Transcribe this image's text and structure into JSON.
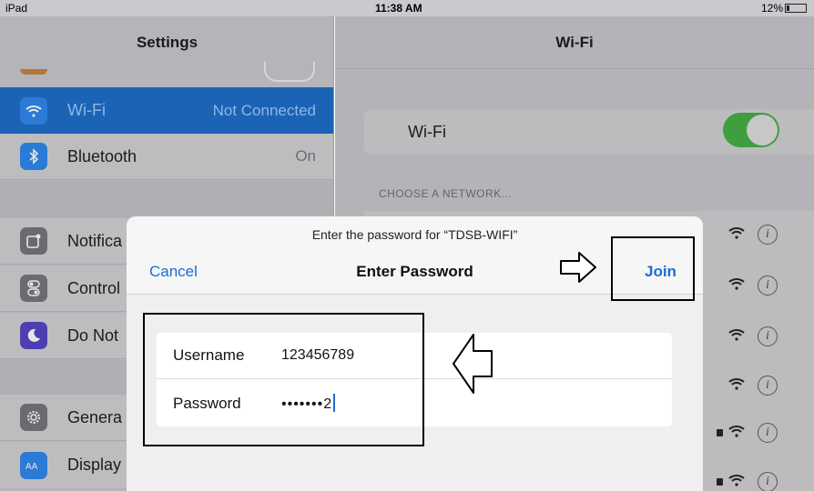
{
  "status_bar": {
    "device": "iPad",
    "time": "11:38 AM",
    "battery": "12%"
  },
  "sidebar": {
    "title": "Settings",
    "items": [
      {
        "label": "Wi-Fi",
        "value": "Not Connected",
        "icon": "wifi-icon",
        "color": "#2a7ad6",
        "selected": true
      },
      {
        "label": "Bluetooth",
        "value": "On",
        "icon": "bluetooth-icon",
        "color": "#2a7ad6"
      },
      {
        "label": "Notifica",
        "icon": "notifications-icon",
        "color": "#6b6b6f"
      },
      {
        "label": "Control",
        "icon": "control-center-icon",
        "color": "#6b6b6f"
      },
      {
        "label": "Do Not",
        "icon": "do-not-disturb-icon",
        "color": "#4e3fb0"
      },
      {
        "label": "Genera",
        "icon": "gear-icon",
        "color": "#6b6b6f"
      },
      {
        "label": "Display",
        "icon": "display-brightness-icon",
        "color": "#2a7ad6"
      }
    ]
  },
  "detail": {
    "title": "Wi-Fi",
    "wifi_label": "Wi-Fi",
    "wifi_on": true,
    "section_header": "CHOOSE A NETWORK..."
  },
  "dialog": {
    "prompt": "Enter the password for “TDSB-WIFI”",
    "title": "Enter Password",
    "cancel": "Cancel",
    "join": "Join",
    "username_label": "Username",
    "username_value": "123456789",
    "password_label": "Password",
    "password_value": "•••••••2"
  },
  "colors": {
    "accent": "#1b6dd1",
    "toggle_on": "#3f9e3f",
    "selected_row": "#1b63b4"
  }
}
